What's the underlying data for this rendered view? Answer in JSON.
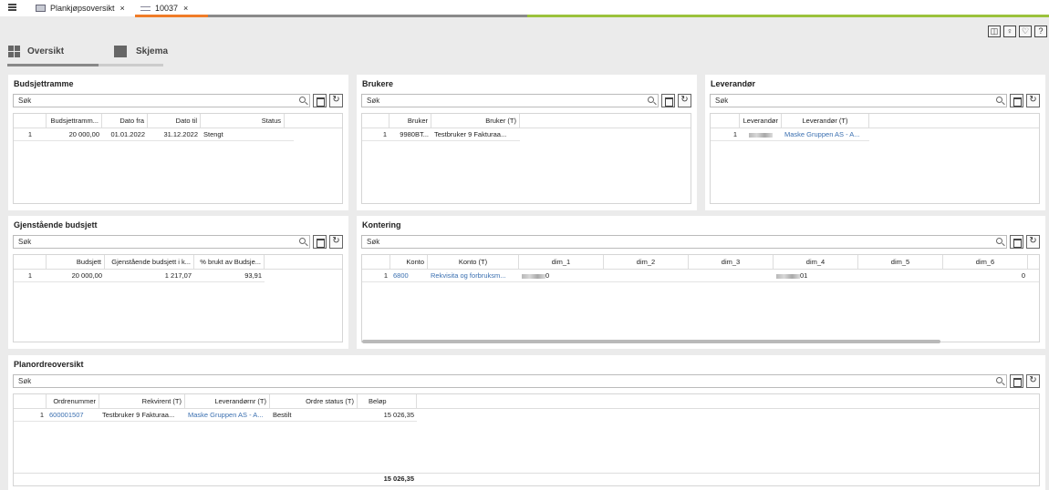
{
  "tabs": [
    {
      "label": "Plankjøpsoversikt",
      "close": "×"
    },
    {
      "label": "10037",
      "close": "×"
    }
  ],
  "colors": {
    "orange": "#f07c28",
    "gray": "#8a8a8a",
    "green": "#9bc23c",
    "link": "#3a6fb0"
  },
  "toolbar_icons": [
    "layout-icon",
    "lightbulb-icon",
    "heart-icon",
    "help-icon"
  ],
  "toolbar_glyphs": [
    "◫",
    "♀",
    "♡",
    "?"
  ],
  "views": {
    "overview": "Oversikt",
    "form": "Skjema"
  },
  "search_placeholder": "Søk",
  "refresh_glyph": "↻",
  "budget": {
    "title": "Budsjettramme",
    "columns": [
      "",
      "Budsjettramm...",
      "Dato fra",
      "Dato til",
      "Status"
    ],
    "rows": [
      [
        "1",
        "20 000,00",
        "01.01.2022",
        "31.12.2022",
        "Stengt"
      ]
    ]
  },
  "users": {
    "title": "Brukere",
    "columns": [
      "",
      "Bruker",
      "Bruker (T)"
    ],
    "rows": [
      [
        "1",
        "9980BT...",
        "Testbruker 9 Fakturaa..."
      ]
    ]
  },
  "supplier": {
    "title": "Leverandør",
    "columns": [
      "",
      "Leverandør",
      "Leverandør (T)"
    ],
    "rows": [
      [
        "1",
        "",
        "Maske Gruppen AS - A..."
      ]
    ]
  },
  "remaining": {
    "title": "Gjenstående budsjett",
    "columns": [
      "",
      "Budsjett",
      "Gjenstående budsjett i k...",
      "% brukt av Budsje..."
    ],
    "rows": [
      [
        "1",
        "20 000,00",
        "1 217,07",
        "93,91"
      ]
    ]
  },
  "accounting": {
    "title": "Kontering",
    "columns": [
      "",
      "Konto",
      "Konto (T)",
      "dim_1",
      "dim_2",
      "dim_3",
      "dim_4",
      "dim_5",
      "dim_6"
    ],
    "rows": [
      [
        "1",
        "6800",
        "Rekvisita og forbruksm...",
        "0",
        "",
        "",
        "01",
        "",
        "0"
      ]
    ]
  },
  "orders": {
    "title": "Planordreoversikt",
    "columns": [
      "",
      "Ordrenummer",
      "Rekvirent (T)",
      "Leverandørnr (T)",
      "Ordre status (T)",
      "Beløp"
    ],
    "rows": [
      [
        "1",
        "600001507",
        "Testbruker 9 Fakturaa...",
        "Maske Gruppen AS - A...",
        "Bestilt",
        "15 026,35"
      ]
    ],
    "total": "15 026,35"
  }
}
